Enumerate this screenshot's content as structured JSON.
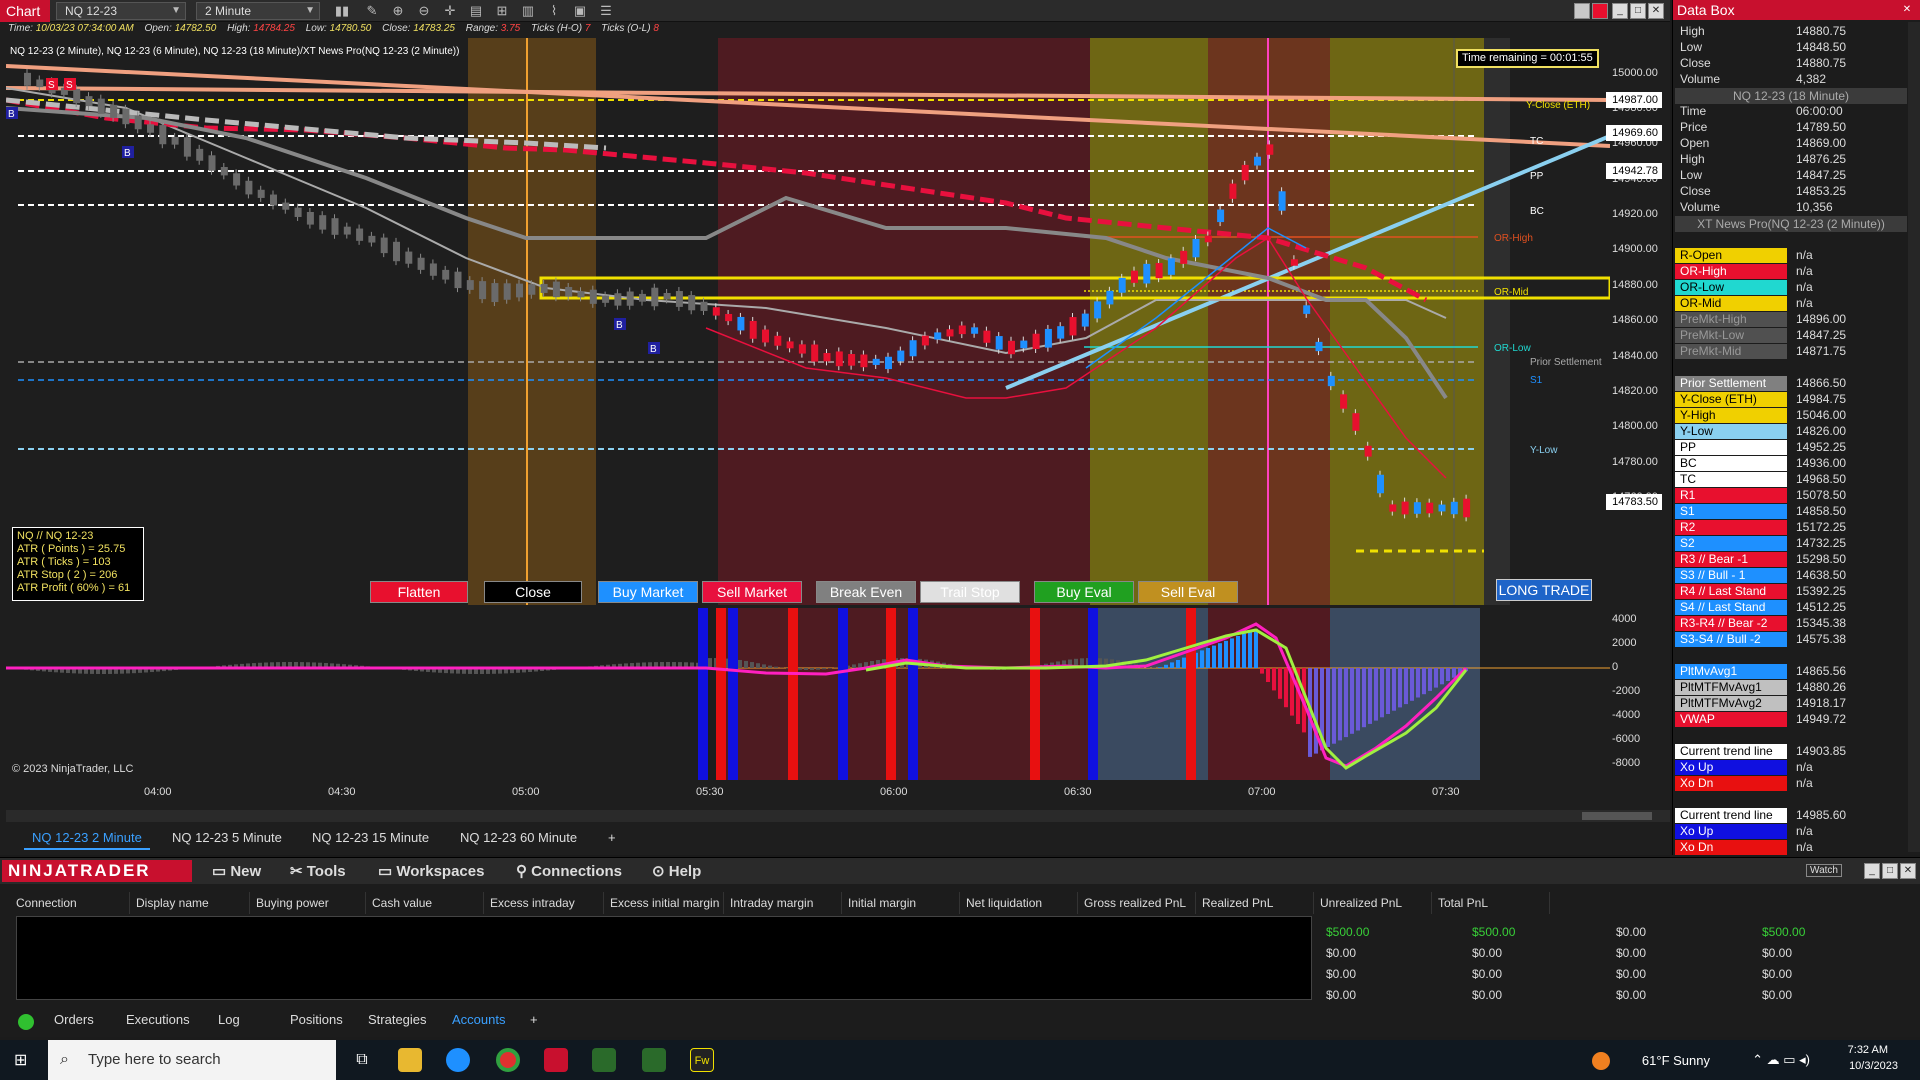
{
  "toolbar": {
    "tag": "Chart",
    "instrument": "NQ 12-23",
    "interval": "2 Minute"
  },
  "infobar": {
    "time_k": "Time:",
    "time_v": "10/03/23 07:34:00 AM",
    "open_k": "Open:",
    "open_v": "14782.50",
    "high_k": "High:",
    "high_v": "14784.25",
    "low_k": "Low:",
    "low_v": "14780.50",
    "close_k": "Close:",
    "close_v": "14783.25",
    "range_k": "Range:",
    "range_v": "3.75",
    "tickshl_k": "Ticks (H-O)",
    "tickshl_v": "7",
    "ticksol_k": "Ticks (O-L)",
    "ticksol_v": "8"
  },
  "series_title": "NQ 12-23 (2 Minute), NQ 12-23 (6 Minute), NQ 12-23 (18 Minute)/XT News Pro(NQ 12-23 (2 Minute))",
  "time_remaining": "Time remaining = 00:01:55",
  "price_axis": [
    "15000.00",
    "14980.00",
    "14960.00",
    "14940.00",
    "14920.00",
    "14900.00",
    "14880.00",
    "14860.00",
    "14840.00",
    "14820.00",
    "14800.00",
    "14780.00",
    "14760.00"
  ],
  "price_tags": [
    "14987.00",
    "14969.60",
    "14942.78",
    "14783.50"
  ],
  "osc_axis": [
    "4000",
    "2000",
    "0",
    "-2000",
    "-4000",
    "-6000",
    "-8000"
  ],
  "time_axis": [
    "04:00",
    "04:30",
    "05:00",
    "05:30",
    "06:00",
    "06:30",
    "07:00",
    "07:30"
  ],
  "level_labels": {
    "yclose": "Y-Close (ETH)",
    "tc": "TC",
    "pp": "PP",
    "bc": "BC",
    "orhigh": "OR-High",
    "ormid": "OR-Mid",
    "orlow": "OR-Low",
    "prior": "Prior Settlement",
    "s1": "S1",
    "ylow": "Y-Low"
  },
  "markers": {
    "s": "S",
    "b": "B"
  },
  "atr_box": {
    "l1": "NQ // NQ 12-23",
    "l2": "ATR ( Points ) = 25.75",
    "l3": "ATR ( Ticks ) = 103",
    "l4": "ATR Stop ( 2 ) = 206",
    "l5": "ATR Profit ( 60% ) = 61"
  },
  "order_buttons": {
    "flatten": "Flatten",
    "close": "Close",
    "buy_market": "Buy Market",
    "sell_market": "Sell Market",
    "break_even": "Break Even",
    "trail_stop": "Trail Stop",
    "buy_eval": "Buy Eval",
    "sell_eval": "Sell Eval"
  },
  "long_trade": "LONG TRADE",
  "copyright": "© 2023 NinjaTrader, LLC",
  "chart_tabs": [
    "NQ 12-23 2 Minute",
    "NQ 12-23 5 Minute",
    "NQ 12-23 15 Minute",
    "NQ 12-23 60 Minute",
    "+"
  ],
  "databox": {
    "title": "Data Box",
    "rows": [
      {
        "label": "High",
        "value": "14880.75",
        "bg": "",
        "fg": "#dddddd"
      },
      {
        "label": "Low",
        "value": "14848.50",
        "bg": "",
        "fg": "#dddddd"
      },
      {
        "label": "Close",
        "value": "14880.75",
        "bg": "",
        "fg": "#dddddd"
      },
      {
        "label": "Volume",
        "value": "4,382",
        "bg": "",
        "fg": "#dddddd"
      },
      {
        "header": "NQ 12-23 (18 Minute)"
      },
      {
        "label": "Time",
        "value": "06:00:00",
        "bg": "",
        "fg": "#dddddd"
      },
      {
        "label": "Price",
        "value": "14789.50",
        "bg": "",
        "fg": "#dddddd"
      },
      {
        "label": "Open",
        "value": "14869.00",
        "bg": "",
        "fg": "#dddddd"
      },
      {
        "label": "High",
        "value": "14876.25",
        "bg": "",
        "fg": "#dddddd"
      },
      {
        "label": "Low",
        "value": "14847.25",
        "bg": "",
        "fg": "#dddddd"
      },
      {
        "label": "Close",
        "value": "14853.25",
        "bg": "",
        "fg": "#dddddd"
      },
      {
        "label": "Volume",
        "value": "10,356",
        "bg": "",
        "fg": "#dddddd"
      },
      {
        "header": "XT News Pro(NQ 12-23 (2 Minute))"
      },
      {
        "label": "",
        "value": "",
        "bg": "",
        "fg": "#dddddd"
      },
      {
        "label": "R-Open",
        "value": "n/a",
        "bg": "#f0d000",
        "fg": "#000000"
      },
      {
        "label": "OR-High",
        "value": "n/a",
        "bg": "#e8102e",
        "fg": "#ffffff"
      },
      {
        "label": "OR-Low",
        "value": "n/a",
        "bg": "#20d8d0",
        "fg": "#000000"
      },
      {
        "label": "OR-Mid",
        "value": "n/a",
        "bg": "#f0d000",
        "fg": "#000000"
      },
      {
        "label": "PreMkt-High",
        "value": "14896.00",
        "bg": "#505050",
        "fg": "#999999"
      },
      {
        "label": "PreMkt-Low",
        "value": "14847.25",
        "bg": "#505050",
        "fg": "#999999"
      },
      {
        "label": "PreMkt-Mid",
        "value": "14871.75",
        "bg": "#505050",
        "fg": "#999999"
      },
      {
        "label": "",
        "value": "",
        "bg": "",
        "fg": "#dddddd"
      },
      {
        "label": "Prior Settlement",
        "value": "14866.50",
        "bg": "#808080",
        "fg": "#ffffff"
      },
      {
        "label": "Y-Close (ETH)",
        "value": "14984.75",
        "bg": "#f0d000",
        "fg": "#000000"
      },
      {
        "label": "Y-High",
        "value": "15046.00",
        "bg": "#f0d000",
        "fg": "#000000"
      },
      {
        "label": "Y-Low",
        "value": "14826.00",
        "bg": "#8ad0f0",
        "fg": "#000000"
      },
      {
        "label": "PP",
        "value": "14952.25",
        "bg": "#ffffff",
        "fg": "#000000"
      },
      {
        "label": "BC",
        "value": "14936.00",
        "bg": "#ffffff",
        "fg": "#000000"
      },
      {
        "label": "TC",
        "value": "14968.50",
        "bg": "#ffffff",
        "fg": "#000000"
      },
      {
        "label": "R1",
        "value": "15078.50",
        "bg": "#e8102e",
        "fg": "#ffffff"
      },
      {
        "label": "S1",
        "value": "14858.50",
        "bg": "#1e90ff",
        "fg": "#ffffff"
      },
      {
        "label": "R2",
        "value": "15172.25",
        "bg": "#e8102e",
        "fg": "#ffffff"
      },
      {
        "label": "S2",
        "value": "14732.25",
        "bg": "#1e90ff",
        "fg": "#ffffff"
      },
      {
        "label": "R3 // Bear -1",
        "value": "15298.50",
        "bg": "#e8102e",
        "fg": "#ffffff"
      },
      {
        "label": "S3 // Bull - 1",
        "value": "14638.50",
        "bg": "#1e90ff",
        "fg": "#ffffff"
      },
      {
        "label": "R4 // Last Stand",
        "value": "15392.25",
        "bg": "#e8102e",
        "fg": "#ffffff"
      },
      {
        "label": "S4 // Last Stand",
        "value": "14512.25",
        "bg": "#1e90ff",
        "fg": "#ffffff"
      },
      {
        "label": "R3-R4 // Bear -2",
        "value": "15345.38",
        "bg": "#e8102e",
        "fg": "#ffffff"
      },
      {
        "label": "S3-S4 // Bull -2",
        "value": "14575.38",
        "bg": "#1e90ff",
        "fg": "#ffffff"
      },
      {
        "label": "",
        "value": "",
        "bg": "",
        "fg": "#dddddd"
      },
      {
        "label": "PltMvAvg1",
        "value": "14865.56",
        "bg": "#1e90ff",
        "fg": "#ffffff"
      },
      {
        "label": "PltMTFMvAvg1",
        "value": "14880.26",
        "bg": "#c0c0c0",
        "fg": "#000000"
      },
      {
        "label": "PltMTFMvAvg2",
        "value": "14918.17",
        "bg": "#c0c0c0",
        "fg": "#000000"
      },
      {
        "label": "VWAP",
        "value": "14949.72",
        "bg": "#e8102e",
        "fg": "#ffffff"
      },
      {
        "label": "",
        "value": "",
        "bg": "",
        "fg": "#dddddd"
      },
      {
        "label": "Current trend line",
        "value": "14903.85",
        "bg": "#ffffff",
        "fg": "#000000"
      },
      {
        "label": "Xo Up",
        "value": "n/a",
        "bg": "#1010e0",
        "fg": "#ffffff"
      },
      {
        "label": "Xo Dn",
        "value": "n/a",
        "bg": "#e81010",
        "fg": "#ffffff"
      },
      {
        "label": "",
        "value": "",
        "bg": "",
        "fg": "#dddddd"
      },
      {
        "label": "Current trend line",
        "value": "14985.60",
        "bg": "#ffffff",
        "fg": "#000000"
      },
      {
        "label": "Xo Up",
        "value": "n/a",
        "bg": "#1010e0",
        "fg": "#ffffff"
      },
      {
        "label": "Xo Dn",
        "value": "n/a",
        "bg": "#e81010",
        "fg": "#ffffff"
      }
    ]
  },
  "control_center": {
    "logo": "NINJATRADER",
    "menu": [
      "New",
      "Tools",
      "Workspaces",
      "Connections",
      "Help"
    ],
    "watch": "Watch",
    "columns": [
      "Connection",
      "Display name",
      "Buying power",
      "Cash value",
      "Excess intraday margin",
      "Excess initial margin",
      "Intraday margin",
      "Initial margin",
      "Net liquidation",
      "Gross realized PnL",
      "Realized PnL",
      "Unrealized PnL",
      "Total PnL"
    ],
    "rows": [
      [
        "$500.00",
        "$500.00",
        "$0.00",
        "$500.00"
      ],
      [
        "$0.00",
        "$0.00",
        "$0.00",
        "$0.00"
      ],
      [
        "$0.00",
        "$0.00",
        "$0.00",
        "$0.00"
      ],
      [
        "$0.00",
        "$0.00",
        "$0.00",
        "$0.00"
      ]
    ],
    "tabs": [
      "Orders",
      "Executions",
      "Log",
      "Positions",
      "Strategies",
      "Accounts",
      "+"
    ]
  },
  "taskbar": {
    "search_placeholder": "Type here to search",
    "weather": "61°F  Sunny",
    "time": "7:32 AM",
    "date": "10/3/2023",
    "app_fw": "Fw"
  },
  "colors": {
    "accent_red": "#c8102e",
    "chart_bg": "#1e1e1e",
    "up_candle": "#1e90ff",
    "down_candle": "#e8102e",
    "yellow": "#f0e000"
  }
}
